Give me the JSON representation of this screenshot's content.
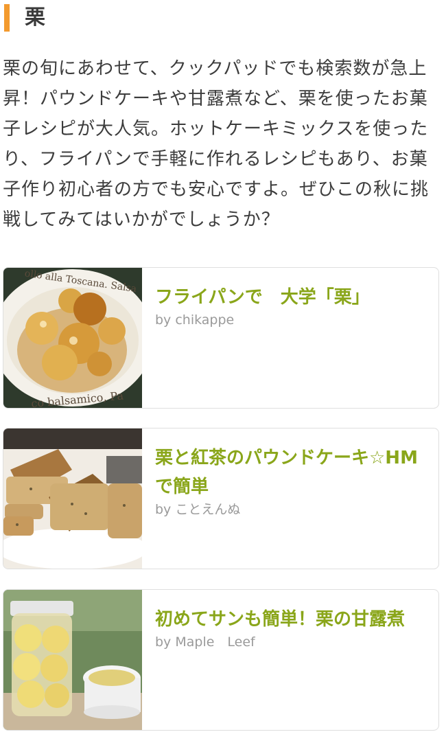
{
  "section": {
    "title": "栗"
  },
  "intro": {
    "text": "栗の旬にあわせて、クックパッドでも検索数が急上昇！パウンドケーキや甘露煮など、栗を使ったお菓子レシピが大人気。ホットケーキミックスを使ったり、フライパンで手軽に作れるレシピもあり、お菓子作り初心者の方でも安心ですよ。ぜひこの秋に挑戦してみてはいかがでしょうか？"
  },
  "recipes": [
    {
      "title": "フライパンで　大学「栗」",
      "author": "by chikappe",
      "thumb": "candied-chestnuts-plate-image"
    },
    {
      "title": "栗と紅茶のパウンドケーキ☆HMで簡単",
      "author": "by ことえんぬ",
      "thumb": "pound-cake-slices-image"
    },
    {
      "title": "初めてサンも簡単！栗の甘露煮",
      "author": "by Maple　Leef",
      "thumb": "chestnut-jar-image"
    }
  ],
  "colors": {
    "accent_bar": "#f39a2e",
    "recipe_title": "#8aa61a",
    "author": "#9a9a9a",
    "card_border": "#dedede"
  }
}
